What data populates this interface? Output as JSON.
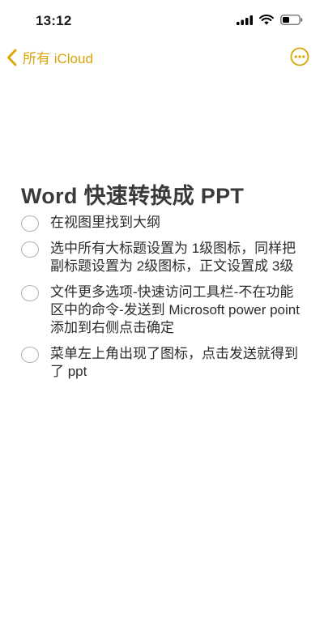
{
  "status_bar": {
    "time": "13:12"
  },
  "nav": {
    "back_label": "所有 iCloud",
    "accent_color": "#d9a404",
    "back_icon": "chevron-left-icon",
    "more_icon": "ellipsis-circle-icon"
  },
  "note": {
    "title": "Word 快速转换成 PPT",
    "items": [
      {
        "text": "在视图里找到大纲",
        "checked": false
      },
      {
        "text": "选中所有大标题设置为 1级图标，同样把副标题设置为 2级图标，正文设置成 3级",
        "checked": false
      },
      {
        "text": "文件更多选项-快速访问工具栏-不在功能区中的命令-发送到 Microsoft power point 添加到右侧点击确定",
        "checked": false
      },
      {
        "text": "菜单左上角出现了图标，点击发送就得到了 ppt",
        "checked": false
      }
    ]
  }
}
